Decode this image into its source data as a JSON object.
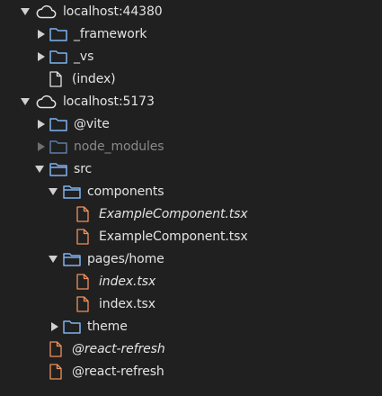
{
  "tree": {
    "host1": {
      "label": "localhost:44380",
      "children": {
        "framework": "_framework",
        "vs": "_vs",
        "index": "(index)"
      }
    },
    "host2": {
      "label": "localhost:5173",
      "children": {
        "vite": "@vite",
        "node_modules": "node_modules",
        "src": {
          "label": "src",
          "components": {
            "label": "components",
            "file_italic": "ExampleComponent.tsx",
            "file": "ExampleComponent.tsx"
          },
          "pages_home": {
            "label": "pages/home",
            "file_italic": "index.tsx",
            "file": "index.tsx"
          },
          "theme": "theme"
        },
        "react_refresh_italic": "@react-refresh",
        "react_refresh": "@react-refresh"
      }
    }
  },
  "colors": {
    "background": "#202020",
    "text": "#e3e3e3",
    "dim_text": "#8a8a8a",
    "folder": "#7fb2f0",
    "folder_dim": "#5a7ea8",
    "file_orange": "#f0915a",
    "file_white": "#e3e3e3",
    "arrow": "#d0d0d0"
  }
}
